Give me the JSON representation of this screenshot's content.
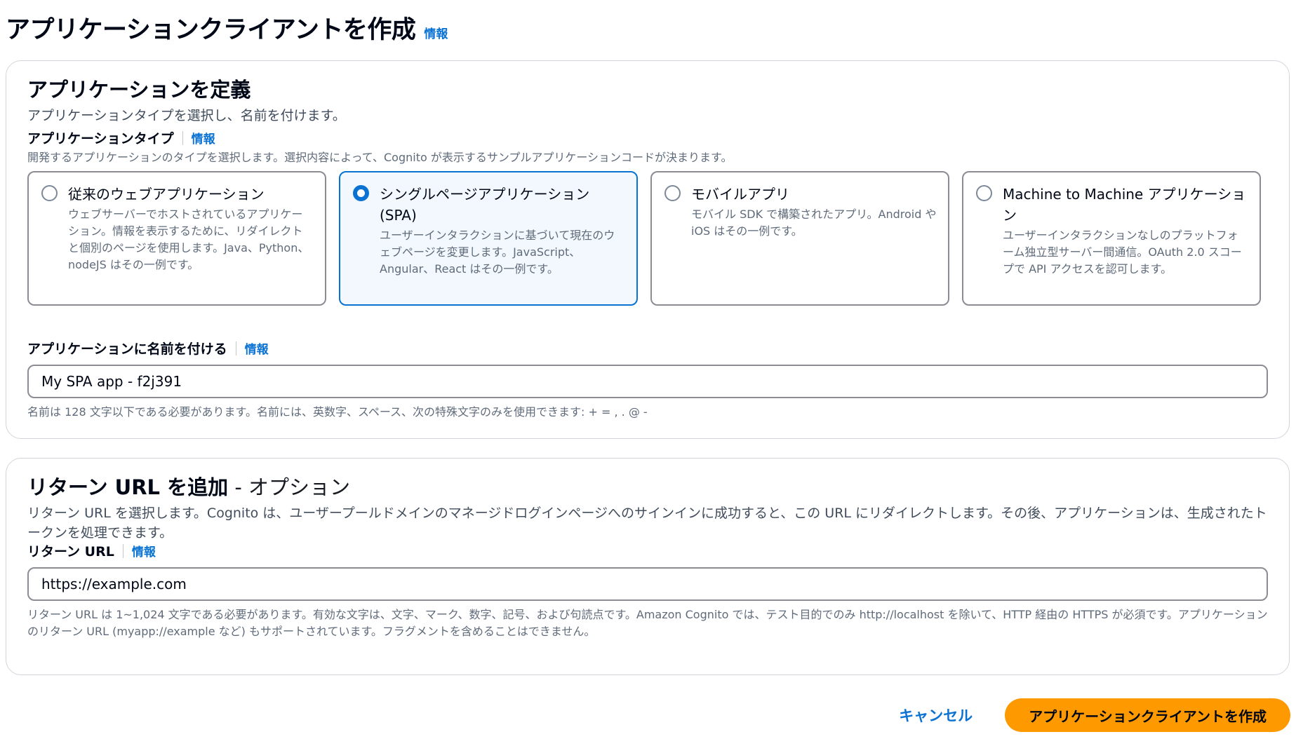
{
  "page": {
    "title": "アプリケーションクライアントを作成",
    "info": "情報"
  },
  "define_app": {
    "title": "アプリケーションを定義",
    "description": "アプリケーションタイプを選択し、名前を付けます。",
    "app_type": {
      "label": "アプリケーションタイプ",
      "info": "情報",
      "description": "開発するアプリケーションのタイプを選択します。選択内容によって、Cognito が表示するサンプルアプリケーションコードが決まります。",
      "options": [
        {
          "title": "従来のウェブアプリケーション",
          "description": "ウェブサーバーでホストされているアプリケーション。情報を表示するために、リダイレクトと個別のページを使用します。Java、Python、nodeJS はその一例です。",
          "selected": false
        },
        {
          "title": "シングルページアプリケーション (SPA)",
          "description": "ユーザーインタラクションに基づいて現在のウェブページを変更します。JavaScript、Angular、React はその一例です。",
          "selected": true
        },
        {
          "title": "モバイルアプリ",
          "description": "モバイル SDK で構築されたアプリ。Android や iOS はその一例です。",
          "selected": false
        },
        {
          "title": "Machine to Machine アプリケーション",
          "description": "ユーザーインタラクションなしのプラットフォーム独立型サーバー間通信。OAuth 2.0 スコープで API アクセスを認可します。",
          "selected": false
        }
      ]
    },
    "app_name": {
      "label": "アプリケーションに名前を付ける",
      "info": "情報",
      "value": "My SPA app - f2j391",
      "constraint": "名前は 128 文字以下である必要があります。名前には、英数字、スペース、次の特殊文字のみを使用できます: + = , . @ -"
    }
  },
  "return_url": {
    "title": "リターン URL を追加",
    "title_suffix": " - オプション",
    "description": "リターン URL を選択します。Cognito は、ユーザープールドメインのマネージドログインページへのサインインに成功すると、この URL にリダイレクトします。その後、アプリケーションは、生成されたトークンを処理できます。",
    "field": {
      "label": "リターン URL",
      "info": "情報",
      "value": "https://example.com",
      "constraint": "リターン URL は 1~1,024 文字である必要があります。有効な文字は、文字、マーク、数字、記号、および句読点です。Amazon Cognito では、テスト目的でのみ http://localhost を除いて、HTTP 経由の HTTPS が必須です。アプリケーションのリターン URL (myapp://example など) もサポートされています。フラグメントを含めることはできません。"
    }
  },
  "actions": {
    "cancel": "キャンセル",
    "create": "アプリケーションクライアントを作成"
  },
  "colors": {
    "link": "#0972d3",
    "primary_button": "#ff9900",
    "selected_tile_border": "#0972d3",
    "selected_tile_bg": "#f2f8fd"
  }
}
